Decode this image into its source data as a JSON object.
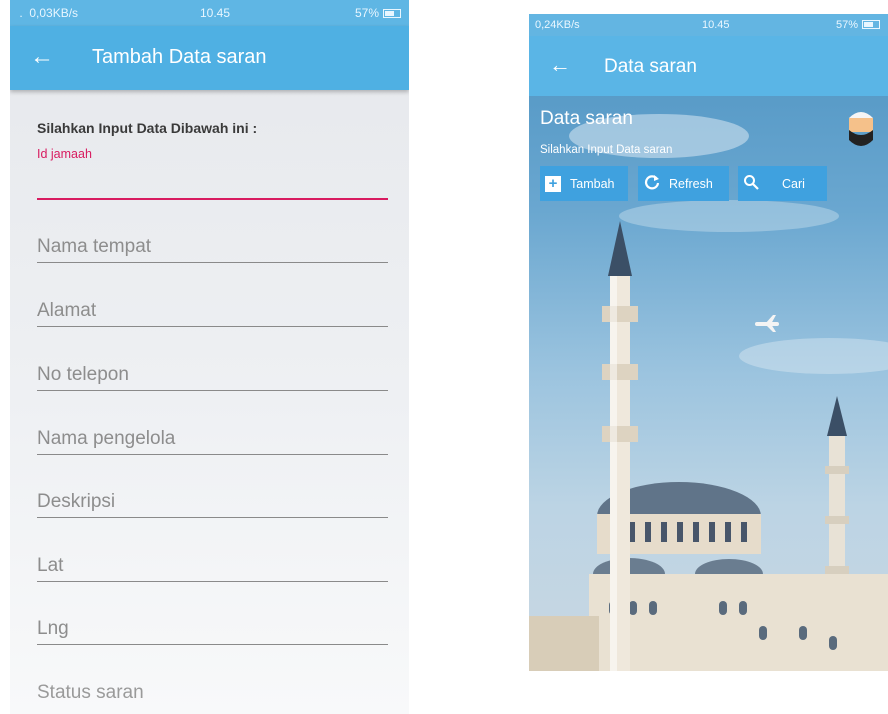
{
  "screen_left": {
    "status_bar": {
      "signal_speed": " .  0,03KB/s",
      "time": "10.45",
      "battery": "57%"
    },
    "app_bar": {
      "title": "Tambah Data saran"
    },
    "form": {
      "heading": "Silahkan Input Data Dibawah ini :",
      "focused_field_label": "Id jamaah",
      "fields": [
        {
          "placeholder": "Nama tempat"
        },
        {
          "placeholder": "Alamat"
        },
        {
          "placeholder": "No telepon"
        },
        {
          "placeholder": "Nama pengelola"
        },
        {
          "placeholder": "Deskripsi"
        },
        {
          "placeholder": "Lat"
        },
        {
          "placeholder": "Lng"
        }
      ],
      "partial_field": "Status saran"
    }
  },
  "screen_right": {
    "status_bar": {
      "signal_speed": "0,24KB/s",
      "time": "10.45",
      "battery": "57%"
    },
    "app_bar": {
      "title": "Data saran"
    },
    "hero": {
      "title": "Data saran",
      "subtitle": "Silahkan Input Data saran"
    },
    "buttons": {
      "add_label": "Tambah",
      "refresh_label": "Refresh",
      "search_label": "Cari"
    }
  },
  "colors": {
    "app_bar": "#4fb0e3",
    "accent_pink": "#d81b60",
    "button_blue": "#3fa1df"
  },
  "icons": {
    "back": "arrow-left-icon",
    "add": "plus-icon",
    "refresh": "refresh-icon",
    "search": "search-icon",
    "avatar": "user-avatar-icon"
  }
}
